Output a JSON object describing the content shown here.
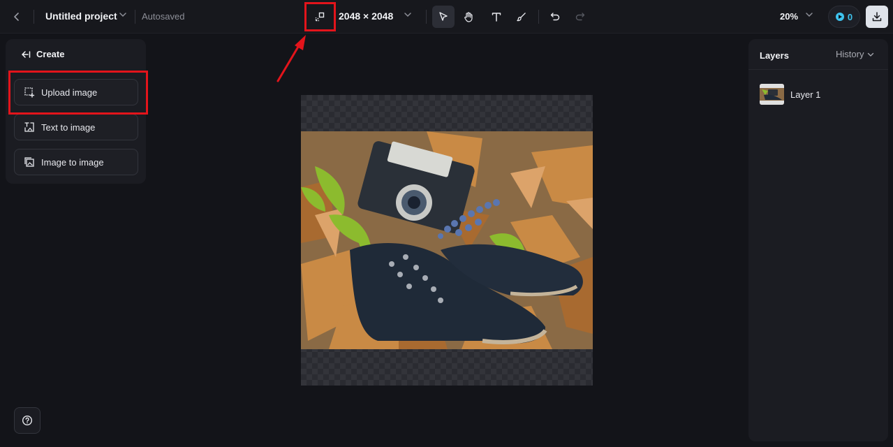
{
  "header": {
    "project_name": "Untitled project",
    "save_status": "Autosaved",
    "canvas_size": "2048 × 2048",
    "zoom": "20%",
    "credits": "0"
  },
  "toolbar": {
    "tools": [
      "select-tool",
      "hand-tool",
      "text-tool",
      "brush-tool"
    ],
    "active_tool": "select-tool",
    "history_actions": [
      "undo",
      "redo"
    ]
  },
  "create_panel": {
    "title": "Create",
    "items": [
      {
        "label": "Upload image",
        "icon": "upload-image-icon"
      },
      {
        "label": "Text to image",
        "icon": "text-to-image-icon"
      },
      {
        "label": "Image to image",
        "icon": "image-to-image-icon"
      }
    ]
  },
  "layers_panel": {
    "title": "Layers",
    "history_tab": "History",
    "layers": [
      {
        "name": "Layer 1"
      }
    ]
  },
  "colors": {
    "background": "#131419",
    "panel": "#1b1c22",
    "highlight": "#e3141b",
    "credit_accent": "#3ec3ee"
  }
}
